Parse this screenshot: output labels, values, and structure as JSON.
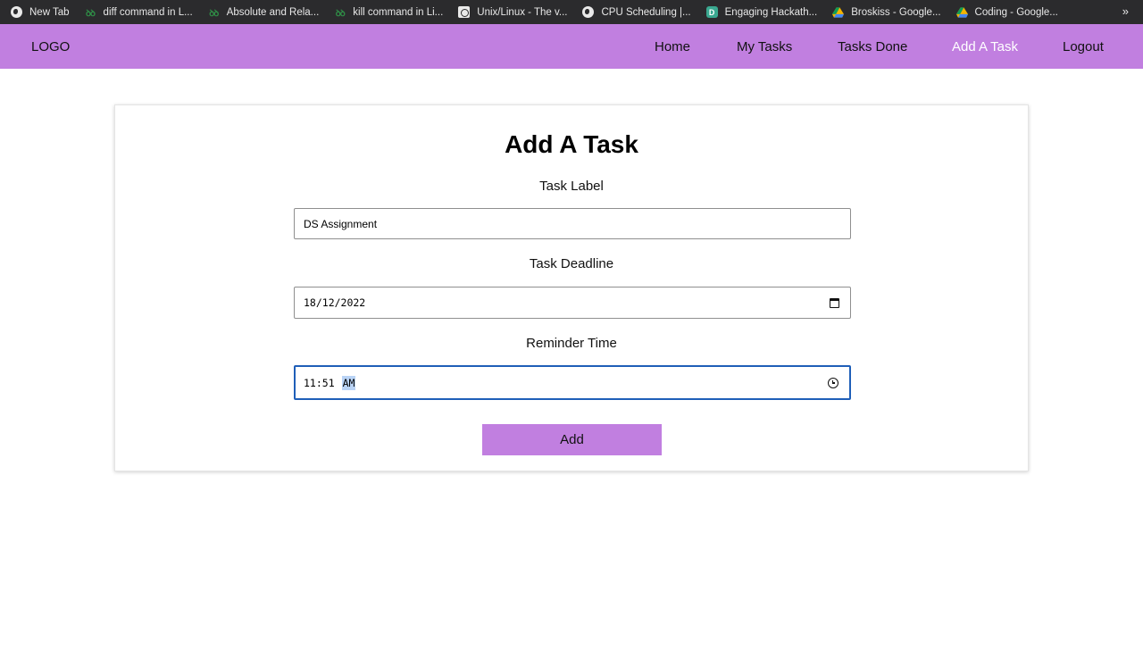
{
  "bookmarks": [
    {
      "label": "New Tab",
      "icon": "globe-icon"
    },
    {
      "label": "diff command in L...",
      "icon": "gfg-icon"
    },
    {
      "label": "Absolute and Rela...",
      "icon": "gfg-icon"
    },
    {
      "label": "kill command in Li...",
      "icon": "gfg-icon"
    },
    {
      "label": "Unix/Linux - The v...",
      "icon": "site-icon"
    },
    {
      "label": "CPU Scheduling |...",
      "icon": "globe-icon"
    },
    {
      "label": "Engaging Hackath...",
      "icon": "d-icon"
    },
    {
      "label": "Broskiss - Google...",
      "icon": "drive-icon"
    },
    {
      "label": "Coding - Google...",
      "icon": "drive-icon"
    }
  ],
  "bookmarks_more": "»",
  "navbar": {
    "logo": "LOGO",
    "links": [
      "Home",
      "My Tasks",
      "Tasks Done",
      "Add A Task",
      "Logout"
    ],
    "active": "Add A Task",
    "color": "#c17fe0"
  },
  "form": {
    "title": "Add A Task",
    "task_label": {
      "label": "Task Label",
      "value": "DS Assignment"
    },
    "task_deadline": {
      "label": "Task Deadline",
      "value": "18/12/2022"
    },
    "reminder_time": {
      "label": "Reminder Time",
      "time": "11:51",
      "period": "AM"
    },
    "submit_label": "Add"
  }
}
